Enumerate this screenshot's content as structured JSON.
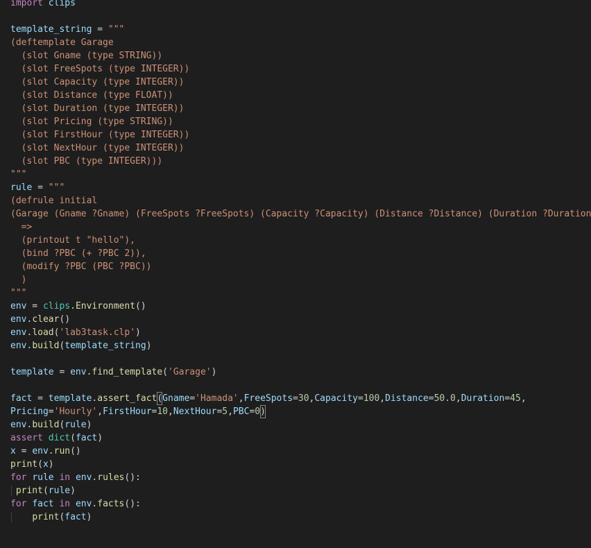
{
  "editor": {
    "colors": {
      "background": "#1e1e1e",
      "default": "#d4d4d4",
      "keyword": "#c586c0",
      "variable": "#9cdcfe",
      "function": "#dcdcaa",
      "string": "#ce9178",
      "number": "#b5cea8",
      "class": "#4ec9b0",
      "indent_guide": "#404040"
    },
    "lines": [
      [
        [
          "kw",
          "import"
        ],
        [
          "op",
          " "
        ],
        [
          "var",
          "clips"
        ]
      ],
      [],
      [
        [
          "var",
          "template_string"
        ],
        [
          "op",
          " = "
        ],
        [
          "str",
          "\"\"\""
        ]
      ],
      [
        [
          "str",
          "(deftemplate Garage"
        ]
      ],
      [
        [
          "str",
          "  (slot Gname (type STRING))"
        ]
      ],
      [
        [
          "str",
          "  (slot FreeSpots (type INTEGER))"
        ]
      ],
      [
        [
          "str",
          "  (slot Capacity (type INTEGER))"
        ]
      ],
      [
        [
          "str",
          "  (slot Distance (type FLOAT))"
        ]
      ],
      [
        [
          "str",
          "  (slot Duration (type INTEGER))"
        ]
      ],
      [
        [
          "str",
          "  (slot Pricing (type STRING))"
        ]
      ],
      [
        [
          "str",
          "  (slot FirstHour (type INTEGER))"
        ]
      ],
      [
        [
          "str",
          "  (slot NextHour (type INTEGER))"
        ]
      ],
      [
        [
          "str",
          "  (slot PBC (type INTEGER)))"
        ]
      ],
      [
        [
          "str",
          "\"\"\""
        ]
      ],
      [
        [
          "var",
          "rule"
        ],
        [
          "op",
          " = "
        ],
        [
          "str",
          "\"\"\""
        ]
      ],
      [
        [
          "str",
          "(defrule initial"
        ]
      ],
      [
        [
          "str",
          "(Garage (Gname ?Gname) (FreeSpots ?FreeSpots) (Capacity ?Capacity) (Distance ?Distance) (Duration ?Duration)"
        ]
      ],
      [
        [
          "str",
          "  =>"
        ]
      ],
      [
        [
          "str",
          "  (printout t \"hello\"),"
        ]
      ],
      [
        [
          "str",
          "  (bind ?PBC (+ ?PBC 2)),"
        ]
      ],
      [
        [
          "str",
          "  (modify ?PBC (PBC ?PBC))"
        ]
      ],
      [
        [
          "str",
          "  )"
        ]
      ],
      [
        [
          "str",
          "\"\"\""
        ]
      ],
      [
        [
          "var",
          "env"
        ],
        [
          "op",
          " = "
        ],
        [
          "cls",
          "clips"
        ],
        [
          "op",
          "."
        ],
        [
          "fn",
          "Environment"
        ],
        [
          "op",
          "()"
        ]
      ],
      [
        [
          "var",
          "env"
        ],
        [
          "op",
          "."
        ],
        [
          "fn",
          "clear"
        ],
        [
          "op",
          "()"
        ]
      ],
      [
        [
          "var",
          "env"
        ],
        [
          "op",
          "."
        ],
        [
          "fn",
          "load"
        ],
        [
          "op",
          "("
        ],
        [
          "str",
          "'lab3task.clp'"
        ],
        [
          "op",
          ")"
        ]
      ],
      [
        [
          "var",
          "env"
        ],
        [
          "op",
          "."
        ],
        [
          "fn",
          "build"
        ],
        [
          "op",
          "("
        ],
        [
          "var",
          "template_string"
        ],
        [
          "op",
          ")"
        ]
      ],
      [],
      [
        [
          "var",
          "template"
        ],
        [
          "op",
          " = "
        ],
        [
          "var",
          "env"
        ],
        [
          "op",
          "."
        ],
        [
          "fn",
          "find_template"
        ],
        [
          "op",
          "("
        ],
        [
          "str",
          "'Garage'"
        ],
        [
          "op",
          ")"
        ]
      ],
      [],
      [
        [
          "var",
          "fact"
        ],
        [
          "op",
          " = "
        ],
        [
          "var",
          "template"
        ],
        [
          "op",
          "."
        ],
        [
          "fn",
          "assert_fact"
        ],
        [
          "box",
          "("
        ],
        [
          "var",
          "Gname"
        ],
        [
          "op",
          "="
        ],
        [
          "str",
          "'Hamada'"
        ],
        [
          "op",
          ","
        ],
        [
          "var",
          "FreeSpots"
        ],
        [
          "op",
          "="
        ],
        [
          "num",
          "30"
        ],
        [
          "op",
          ","
        ],
        [
          "var",
          "Capacity"
        ],
        [
          "op",
          "="
        ],
        [
          "num",
          "100"
        ],
        [
          "op",
          ","
        ],
        [
          "var",
          "Distance"
        ],
        [
          "op",
          "="
        ],
        [
          "num",
          "50.0"
        ],
        [
          "op",
          ","
        ],
        [
          "var",
          "Duration"
        ],
        [
          "op",
          "="
        ],
        [
          "num",
          "45"
        ],
        [
          "op",
          ","
        ]
      ],
      [
        [
          "var",
          "Pricing"
        ],
        [
          "op",
          "="
        ],
        [
          "str",
          "'Hourly'"
        ],
        [
          "op",
          ","
        ],
        [
          "var",
          "FirstHour"
        ],
        [
          "op",
          "="
        ],
        [
          "num",
          "10"
        ],
        [
          "op",
          ","
        ],
        [
          "var",
          "NextHour"
        ],
        [
          "op",
          "="
        ],
        [
          "num",
          "5"
        ],
        [
          "op",
          ","
        ],
        [
          "var",
          "PBC"
        ],
        [
          "op",
          "="
        ],
        [
          "num",
          "0"
        ],
        [
          "box",
          ")"
        ]
      ],
      [
        [
          "var",
          "env"
        ],
        [
          "op",
          "."
        ],
        [
          "fn",
          "build"
        ],
        [
          "op",
          "("
        ],
        [
          "var",
          "rule"
        ],
        [
          "op",
          ")"
        ]
      ],
      [
        [
          "kw",
          "assert"
        ],
        [
          "op",
          " "
        ],
        [
          "cls",
          "dict"
        ],
        [
          "op",
          "("
        ],
        [
          "var",
          "fact"
        ],
        [
          "op",
          ")"
        ]
      ],
      [
        [
          "var",
          "x"
        ],
        [
          "op",
          " = "
        ],
        [
          "var",
          "env"
        ],
        [
          "op",
          "."
        ],
        [
          "fn",
          "run"
        ],
        [
          "op",
          "()"
        ]
      ],
      [
        [
          "fn",
          "print"
        ],
        [
          "op",
          "("
        ],
        [
          "var",
          "x"
        ],
        [
          "op",
          ")"
        ]
      ],
      [
        [
          "kw",
          "for"
        ],
        [
          "op",
          " "
        ],
        [
          "var",
          "rule"
        ],
        [
          "op",
          " "
        ],
        [
          "kw",
          "in"
        ],
        [
          "op",
          " "
        ],
        [
          "var",
          "env"
        ],
        [
          "op",
          "."
        ],
        [
          "fn",
          "rules"
        ],
        [
          "op",
          "():"
        ]
      ],
      [
        [
          "op",
          " "
        ],
        [
          "fn",
          "print"
        ],
        [
          "op",
          "("
        ],
        [
          "var",
          "rule"
        ],
        [
          "op",
          ")"
        ]
      ],
      [
        [
          "kw",
          "for"
        ],
        [
          "op",
          " "
        ],
        [
          "var",
          "fact"
        ],
        [
          "op",
          " "
        ],
        [
          "kw",
          "in"
        ],
        [
          "op",
          " "
        ],
        [
          "var",
          "env"
        ],
        [
          "op",
          "."
        ],
        [
          "fn",
          "facts"
        ],
        [
          "op",
          "():"
        ]
      ],
      [
        [
          "op",
          "    "
        ],
        [
          "fn",
          "print"
        ],
        [
          "op",
          "("
        ],
        [
          "var",
          "fact"
        ],
        [
          "op",
          ")"
        ]
      ]
    ]
  }
}
